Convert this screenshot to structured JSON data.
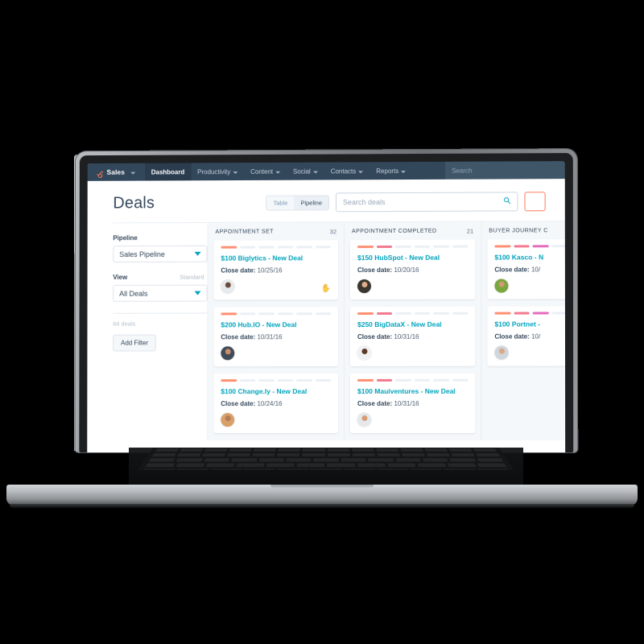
{
  "nav": {
    "brand": "Sales",
    "brand_icon": "hubspot-sprocket-icon",
    "items": [
      {
        "label": "Dashboard",
        "active": true,
        "caret": false
      },
      {
        "label": "Productivity",
        "active": false,
        "caret": true
      },
      {
        "label": "Content",
        "active": false,
        "caret": true
      },
      {
        "label": "Social",
        "active": false,
        "caret": true
      },
      {
        "label": "Contacts",
        "active": false,
        "caret": true
      },
      {
        "label": "Reports",
        "active": false,
        "caret": true
      }
    ],
    "search_placeholder": "Search"
  },
  "header": {
    "title": "Deals",
    "view_toggle": [
      {
        "label": "Table",
        "selected": false
      },
      {
        "label": "Pipeline",
        "selected": true
      }
    ],
    "search_placeholder": "Search deals",
    "search_icon": "magnifier-icon",
    "cta_label": ""
  },
  "sidebar": {
    "pipeline_label": "Pipeline",
    "pipeline_value": "Sales Pipeline",
    "view_label": "View",
    "view_sublabel": "Standard",
    "view_value": "All Deals",
    "deal_count": "84 deals",
    "add_filter_label": "Add Filter"
  },
  "colors": {
    "navbar": "#33475b",
    "accent_teal": "#00a4bd",
    "accent_orange": "#ff7a59",
    "board_bg": "#f5f8fa",
    "stage_one": "#ff8f73",
    "stage_two": "#f2798f",
    "stage_three": "#e36bbd",
    "segment_empty": "#eaf0f6"
  },
  "board": {
    "columns": [
      {
        "name": "APPOINTMENT SET",
        "count": "32",
        "filled_segments": 1,
        "total_segments": 6,
        "cards": [
          {
            "title": "$100 Biglytics - New Deal",
            "close_label": "Close date:",
            "close_date": "10/25/16",
            "avatar": {
              "skin": "#6b4a3a",
              "shirt": "#e8ebee"
            },
            "has_cursor": true
          },
          {
            "title": "$200 Hub.IO - New Deal",
            "close_label": "Close date:",
            "close_date": "10/31/16",
            "avatar": {
              "skin": "#c98e6c",
              "shirt": "#3f4b58"
            },
            "has_cursor": false
          },
          {
            "title": "$100 Change.ly - New Deal",
            "close_label": "Close date:",
            "close_date": "10/24/16",
            "avatar": {
              "skin": "#b87a52",
              "shirt": "#d8a06a"
            },
            "has_cursor": false
          }
        ]
      },
      {
        "name": "APPOINTMENT COMPLETED",
        "count": "21",
        "filled_segments": 2,
        "total_segments": 6,
        "cards": [
          {
            "title": "$150 HubSpot - New Deal",
            "close_label": "Close date:",
            "close_date": "10/20/16",
            "avatar": {
              "skin": "#e0b08c",
              "shirt": "#3a3630"
            },
            "has_cursor": false
          },
          {
            "title": "$250 BigDataX - New Deal",
            "close_label": "Close date:",
            "close_date": "10/31/16",
            "avatar": {
              "skin": "#5a3a28",
              "shirt": "#f0f2f4"
            },
            "has_cursor": false
          },
          {
            "title": "$100 Mauiventures - New Deal",
            "close_label": "Close date:",
            "close_date": "10/31/16",
            "avatar": {
              "skin": "#d79c74",
              "shirt": "#e6e9ec"
            },
            "has_cursor": false
          }
        ]
      },
      {
        "name": "BUYER JOURNEY C",
        "count": "",
        "filled_segments": 3,
        "total_segments": 6,
        "cards": [
          {
            "title": "$100 Kasco - N",
            "close_label": "Close date:",
            "close_date": "10/",
            "avatar": {
              "skin": "#d19a72",
              "shirt": "#7aa63f"
            },
            "has_cursor": false
          },
          {
            "title": "$100 Portnet - ",
            "close_label": "Close date:",
            "close_date": "10/",
            "avatar": {
              "skin": "#dba985",
              "shirt": "#cfd6dc"
            },
            "has_cursor": false
          }
        ]
      }
    ]
  }
}
